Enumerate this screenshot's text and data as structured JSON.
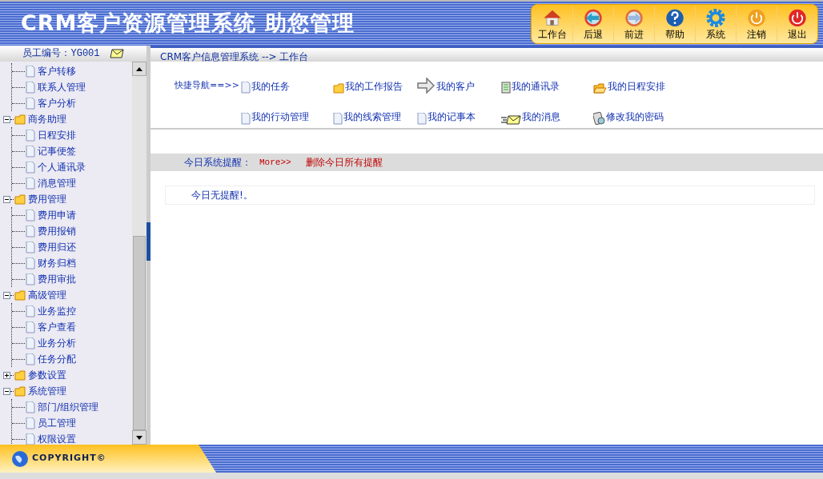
{
  "header": {
    "title": "CRM客户资源管理系统 助您管理"
  },
  "toolbar": [
    {
      "label": "工作台"
    },
    {
      "label": "后退"
    },
    {
      "label": "前进"
    },
    {
      "label": "帮助"
    },
    {
      "label": "系统"
    },
    {
      "label": "注销"
    },
    {
      "label": "退出"
    }
  ],
  "sidebar": {
    "employee": "员工编号：YG001",
    "tree": [
      {
        "children": [
          {
            "label": "客户转移"
          },
          {
            "label": "联系人管理"
          },
          {
            "label": "客户分析"
          }
        ]
      },
      {
        "label": "商务助理",
        "expanded": true,
        "children": [
          {
            "label": "日程安排"
          },
          {
            "label": "记事便签"
          },
          {
            "label": "个人通讯录"
          },
          {
            "label": "消息管理"
          }
        ]
      },
      {
        "label": "费用管理",
        "expanded": true,
        "children": [
          {
            "label": "费用申请"
          },
          {
            "label": "费用报销"
          },
          {
            "label": "费用归还"
          },
          {
            "label": "财务归档"
          },
          {
            "label": "费用审批"
          }
        ]
      },
      {
        "label": "高级管理",
        "expanded": true,
        "children": [
          {
            "label": "业务监控"
          },
          {
            "label": "客户查看"
          },
          {
            "label": "业务分析"
          },
          {
            "label": "任务分配"
          }
        ]
      },
      {
        "label": "参数设置",
        "expanded": false
      },
      {
        "label": "系统管理",
        "expanded": true,
        "children": [
          {
            "label": "部门/组织管理"
          },
          {
            "label": "员工管理"
          },
          {
            "label": "权限设置"
          }
        ]
      }
    ]
  },
  "breadcrumb": "CRM客户信息管理系统 --> 工作台",
  "quick_nav": {
    "label": "快捷导航==>>",
    "links": [
      {
        "label": "我的任务"
      },
      {
        "label": "我的工作报告"
      },
      {
        "label": "我的客户"
      },
      {
        "label": "我的通讯录"
      },
      {
        "label": "我的日程安排"
      },
      {
        "label": "我的行动管理"
      },
      {
        "label": "我的线索管理"
      },
      {
        "label": "我的记事本"
      },
      {
        "label": "我的消息"
      },
      {
        "label": "修改我的密码"
      }
    ]
  },
  "reminders": {
    "label": "今日系统提醒：",
    "more": "More>>",
    "delete_all": "删除今日所有提醒",
    "message": "今日无提醒!。"
  },
  "footer": {
    "copyright": "COPYRIGHT©"
  }
}
